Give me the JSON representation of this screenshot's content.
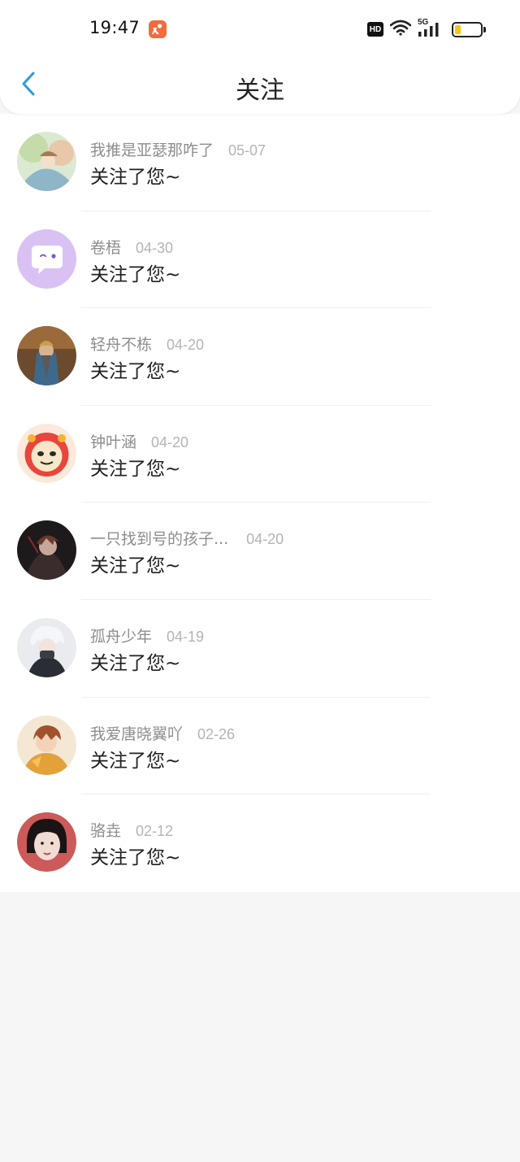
{
  "status_bar": {
    "time": "19:47",
    "hd_label": "HD",
    "network_label": "5G",
    "battery_level": 0.22,
    "battery_color": "#f5c518",
    "app_badge_color": "#f26b3a"
  },
  "nav": {
    "title": "关注",
    "back_icon": "chevron-left-icon",
    "accent": "#2d9cdb"
  },
  "items": [
    {
      "name": "我推是亚瑟那咋了",
      "date": "05-07",
      "message": "关注了您~"
    },
    {
      "name": "卷梧",
      "date": "04-30",
      "message": "关注了您~"
    },
    {
      "name": "轻舟不栋",
      "date": "04-20",
      "message": "关注了您~"
    },
    {
      "name": "钟叶涵",
      "date": "04-20",
      "message": "关注了您~"
    },
    {
      "name": "一只找到号的孩子...",
      "date": "04-20",
      "message": "关注了您~"
    },
    {
      "name": "孤舟少年",
      "date": "04-19",
      "message": "关注了您~"
    },
    {
      "name": "我爱唐晓翼吖",
      "date": "02-26",
      "message": "关注了您~"
    },
    {
      "name": "骆垚",
      "date": "02-12",
      "message": "关注了您~"
    }
  ]
}
